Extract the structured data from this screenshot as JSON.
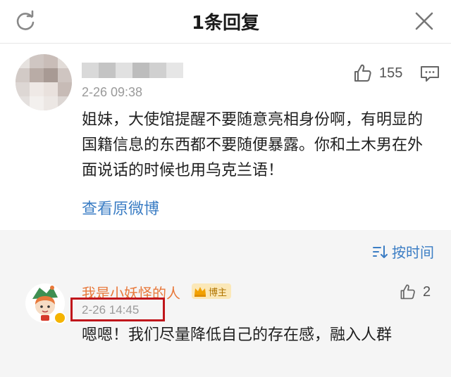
{
  "header": {
    "title": "1条回复",
    "refresh_icon": "refresh-icon",
    "close_icon": "close-icon"
  },
  "comment": {
    "author_blurred": true,
    "time": "2-26 09:38",
    "likes": "155",
    "text": "姐妹，大使馆提醒不要随意亮相身份啊，有明显的国籍信息的东西都不要随便暴露。你和土木男在外面说话的时候也用乌克兰语！",
    "view_original": "查看原微博"
  },
  "replies": {
    "sort_label": "按时间",
    "items": [
      {
        "author": "我是小妖怪的人",
        "badge": "博主",
        "time": "2-26 14:45",
        "likes": "2",
        "text": "嗯嗯！我们尽量降低自己的存在感，融入人群"
      }
    ]
  },
  "colors": {
    "link": "#3b7dc4",
    "reply_author": "#e8783a",
    "highlight_box": "#c0161b",
    "badge_bg": "#fbe8b8"
  }
}
